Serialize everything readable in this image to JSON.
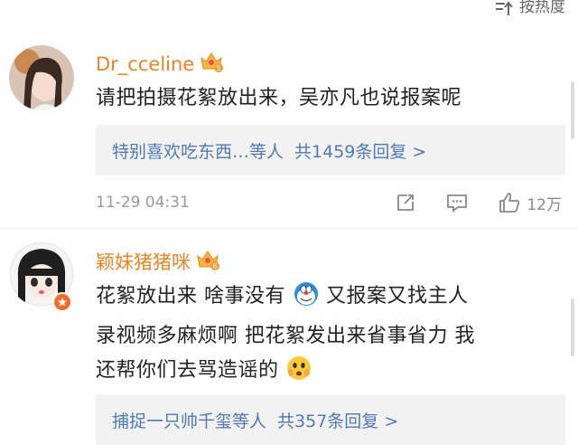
{
  "sort": {
    "label": "按热度"
  },
  "comments": [
    {
      "username": "Dr_cceline",
      "vip_level": "5",
      "text": "请把拍摄花絮放出来，吴亦凡也说报案呢",
      "reply_preview": "特别喜欢吃东西…等人",
      "reply_count": "共1459条回复 >",
      "time": "11-29 04:31",
      "likes": "12万"
    },
    {
      "username": "颖妹猪猪咪",
      "vip_level": "6",
      "text_line1": "花絮放出来 啥事没有",
      "text_line1b": " 又报案又找主人",
      "text_line2": "录视频多麻烦啊 把花絮发出来省事省力 我",
      "text_line3": "还帮你们去骂造谣的",
      "reply_preview": "捕捉一只帅千玺等人",
      "reply_count": "共357条回复 >"
    }
  ],
  "colors": {
    "username": "#e98427",
    "link": "#4f7ab6",
    "reply_bg": "#f2f2f2",
    "meta": "#999999"
  }
}
